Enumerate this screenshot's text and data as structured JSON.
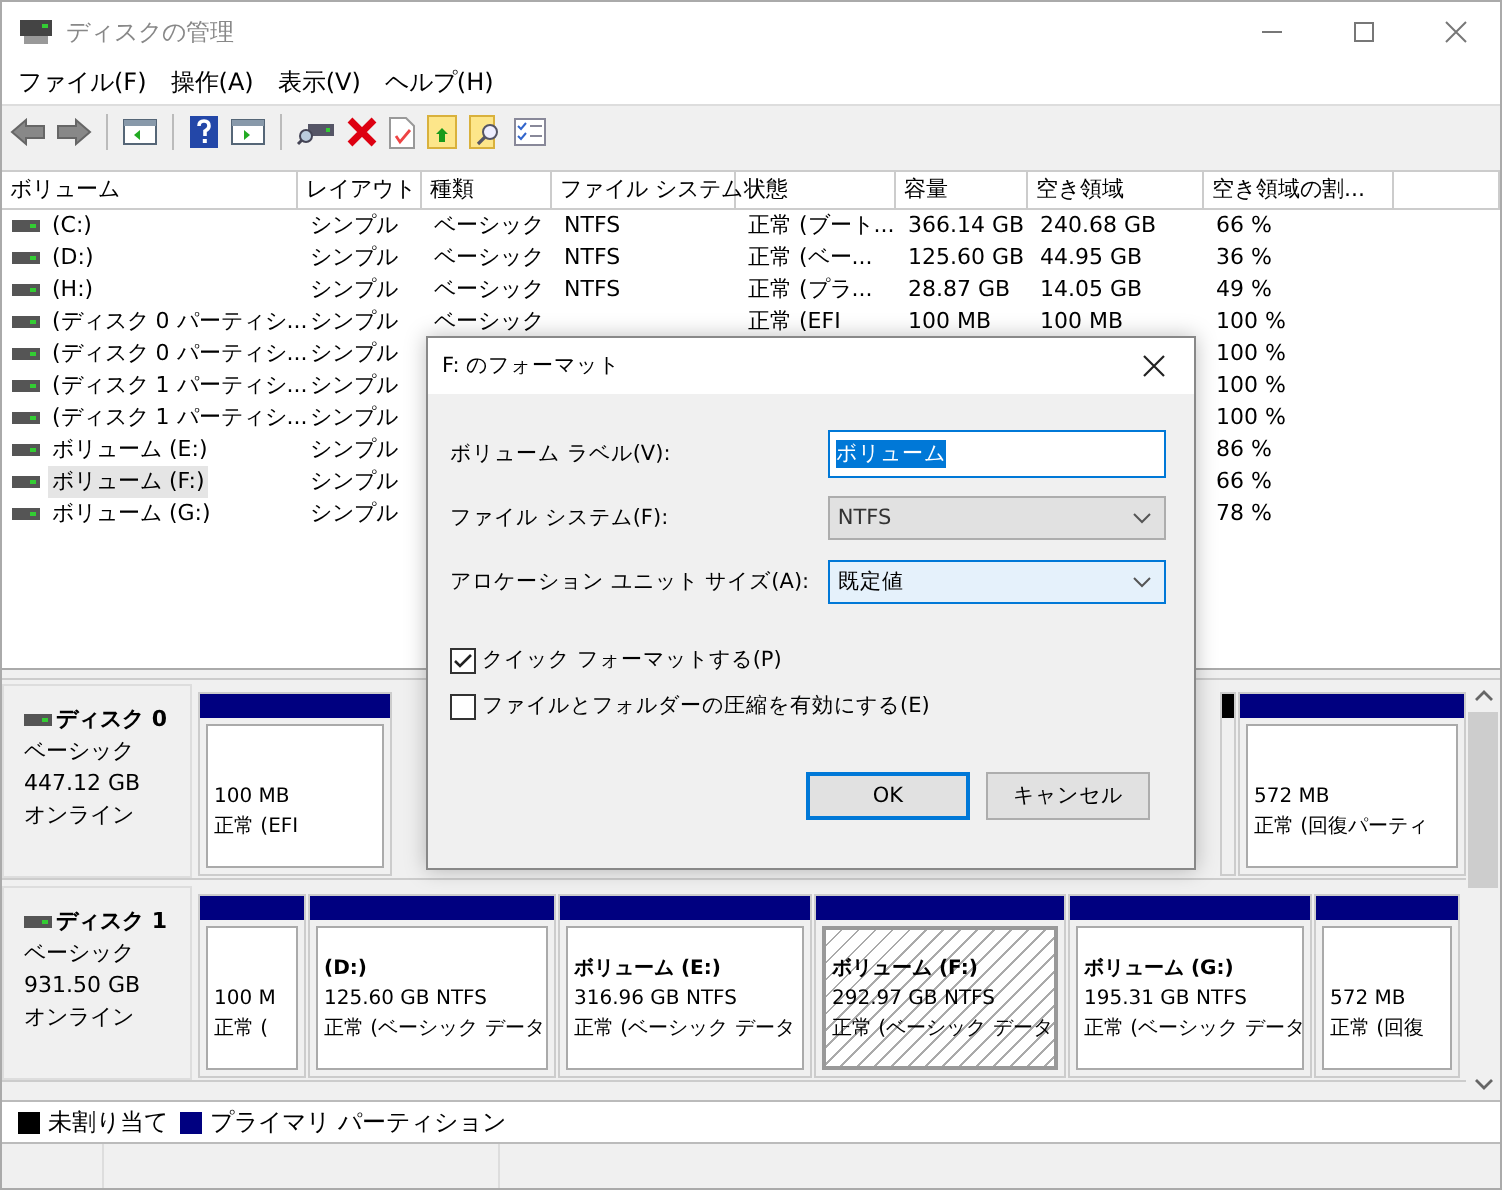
{
  "window": {
    "title": "ディスクの管理"
  },
  "menu": [
    "ファイル(F)",
    "操作(A)",
    "表示(V)",
    "ヘルプ(H)"
  ],
  "volume_table": {
    "columns": [
      "ボリューム",
      "レイアウト",
      "種類",
      "ファイル システム",
      "状態",
      "容量",
      "空き領域",
      "空き領域の割..."
    ],
    "rows": [
      {
        "volume": "(C:)",
        "layout": "シンプル",
        "type": "ベーシック",
        "file_system": "NTFS",
        "status": "正常 (ブート...",
        "capacity": "366.14 GB",
        "free": "240.68 GB",
        "free_percent": "66 %",
        "selected": false
      },
      {
        "volume": "(D:)",
        "layout": "シンプル",
        "type": "ベーシック",
        "file_system": "NTFS",
        "status": "正常 (ベー...",
        "capacity": "125.60 GB",
        "free": "44.95 GB",
        "free_percent": "36 %",
        "selected": false
      },
      {
        "volume": "(H:)",
        "layout": "シンプル",
        "type": "ベーシック",
        "file_system": "NTFS",
        "status": "正常 (プラ...",
        "capacity": "28.87 GB",
        "free": "14.05 GB",
        "free_percent": "49 %",
        "selected": false
      },
      {
        "volume": "(ディスク 0 パーティシ...",
        "layout": "シンプル",
        "type": "ベーシック",
        "status": "正常 (EFI",
        "capacity": "100 MB",
        "free": "100 MB",
        "free_percent": "100 %",
        "selected": false
      },
      {
        "volume": "(ディスク 0 パーティシ...",
        "layout": "シンプル",
        "free_percent": "100 %",
        "selected": false
      },
      {
        "volume": "(ディスク 1 パーティシ...",
        "layout": "シンプル",
        "free_percent": "100 %",
        "selected": false
      },
      {
        "volume": "(ディスク 1 パーティシ...",
        "layout": "シンプル",
        "free_percent": "100 %",
        "selected": false
      },
      {
        "volume": "ボリューム (E:)",
        "layout": "シンプル",
        "free_percent": "86 %",
        "selected": false
      },
      {
        "volume": "ボリューム (F:)",
        "layout": "シンプル",
        "free_percent": "66 %",
        "selected": true
      },
      {
        "volume": "ボリューム (G:)",
        "layout": "シンプル",
        "free_percent": "78 %",
        "selected": false
      }
    ]
  },
  "disks": [
    {
      "name": "ディスク 0",
      "type": "ベーシック",
      "size": "447.12 GB",
      "status": "オンライン",
      "partitions": [
        {
          "kind": "primary",
          "size": "100 MB",
          "status": "正常 (EFI",
          "selected": false
        },
        {
          "kind": "gap"
        },
        {
          "kind": "unallocated"
        },
        {
          "kind": "primary",
          "size": "572 MB",
          "status": "正常 (回復パーティ",
          "selected": false
        }
      ]
    },
    {
      "name": "ディスク 1",
      "type": "ベーシック",
      "size": "931.50 GB",
      "status": "オンライン",
      "partitions": [
        {
          "kind": "primary",
          "size": "100 M",
          "status": "正常 (",
          "selected": false
        },
        {
          "kind": "primary",
          "label": "(D:)",
          "size": "125.60 GB NTFS",
          "status": "正常 (ベーシック データ",
          "selected": false
        },
        {
          "kind": "primary",
          "label": "ボリューム  (E:)",
          "size": "316.96 GB NTFS",
          "status": "正常 (ベーシック データ",
          "selected": false
        },
        {
          "kind": "primary",
          "label": "ボリューム  (F:)",
          "size": "292.97 GB NTFS",
          "status": "正常 (ベーシック データ",
          "selected": true
        },
        {
          "kind": "primary",
          "label": "ボリューム  (G:)",
          "size": "195.31 GB NTFS",
          "status": "正常 (ベーシック データ",
          "selected": false
        },
        {
          "kind": "primary",
          "size": "572 MB",
          "status": "正常 (回復",
          "selected": false
        }
      ]
    }
  ],
  "legend": [
    {
      "label": "未割り当て",
      "color": "#000000"
    },
    {
      "label": "プライマリ パーティション",
      "color": "#000080"
    }
  ],
  "format_dialog": {
    "title": "F: のフォーマット",
    "fields": [
      {
        "kind": "text",
        "label": "ボリューム ラベル(V):",
        "value": "ボリューム",
        "value_selected": true
      },
      {
        "kind": "dropdown",
        "label": "ファイル システム(F):",
        "value": "NTFS",
        "disabled": true
      },
      {
        "kind": "dropdown",
        "label": "アロケーション ユニット サイズ(A):",
        "value": "既定値",
        "disabled": false
      }
    ],
    "checkboxes": [
      {
        "label": "クイック フォーマットする(P)",
        "checked": true
      },
      {
        "label": "ファイルとフォルダーの圧縮を有効にする(E)",
        "checked": false
      }
    ],
    "buttons": [
      {
        "label": "OK",
        "default": true
      },
      {
        "label": "キャンセル",
        "default": false
      }
    ]
  }
}
